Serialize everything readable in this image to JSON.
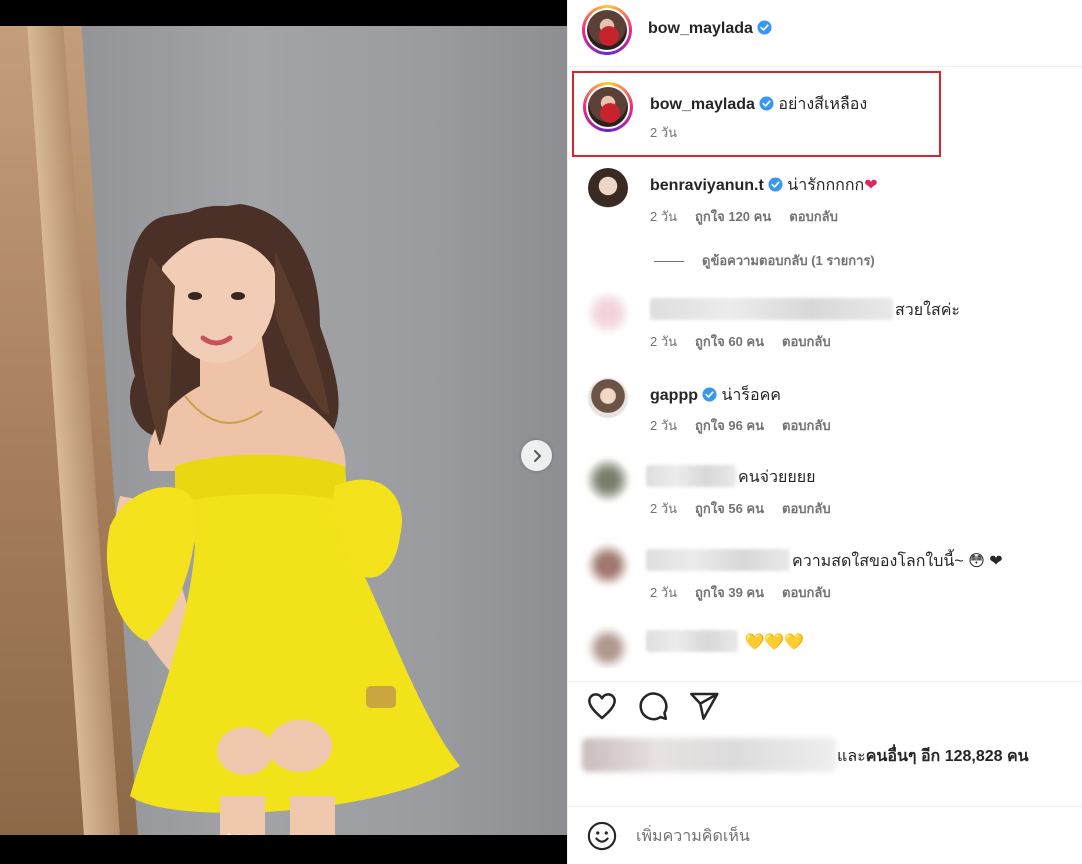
{
  "post": {
    "username": "bow_maylada",
    "caption": "อย่างสีเหลือง",
    "caption_time": "2 วัน"
  },
  "comments": [
    {
      "username": "benraviyanun.t",
      "text": "น่ารักกกกก",
      "emoji": "❤",
      "time": "2 วัน",
      "likes": "ถูกใจ 120 คน",
      "reply": "ตอบกลับ"
    },
    {
      "username": "",
      "text": "สวยใสค่ะ",
      "time": "2 วัน",
      "likes": "ถูกใจ 60 คน",
      "reply": "ตอบกลับ"
    },
    {
      "username": "gappp",
      "text": "น่าร็อคค",
      "time": "2 วัน",
      "likes": "ถูกใจ 96 คน",
      "reply": "ตอบกลับ"
    },
    {
      "username": "",
      "text": "คนจ่วยยยย",
      "time": "2 วัน",
      "likes": "ถูกใจ 56 คน",
      "reply": "ตอบกลับ"
    },
    {
      "username": "",
      "text": "ความสดใสของโลกใบนี้~",
      "emoji": "😳 ❤",
      "time": "2 วัน",
      "likes": "ถูกใจ 39 คน",
      "reply": "ตอบกลับ"
    },
    {
      "username": "",
      "text": "💛💛💛"
    }
  ],
  "view_replies": "ดูข้อความตอบกลับ (1 รายการ)",
  "likes_summary": {
    "prefix": "และ",
    "bold": "คนอื่นๆ อีก 128,828 คน"
  },
  "add_comment": {
    "placeholder": "เพิ่มความคิดเห็น"
  },
  "icons": [
    "heart-icon",
    "comment-icon",
    "share-icon",
    "emoji-icon",
    "chevron-right-icon",
    "verified-icon"
  ],
  "colors": {
    "verified": "#3897f0",
    "highlight_border": "#d9242a",
    "muted": "#737373"
  }
}
